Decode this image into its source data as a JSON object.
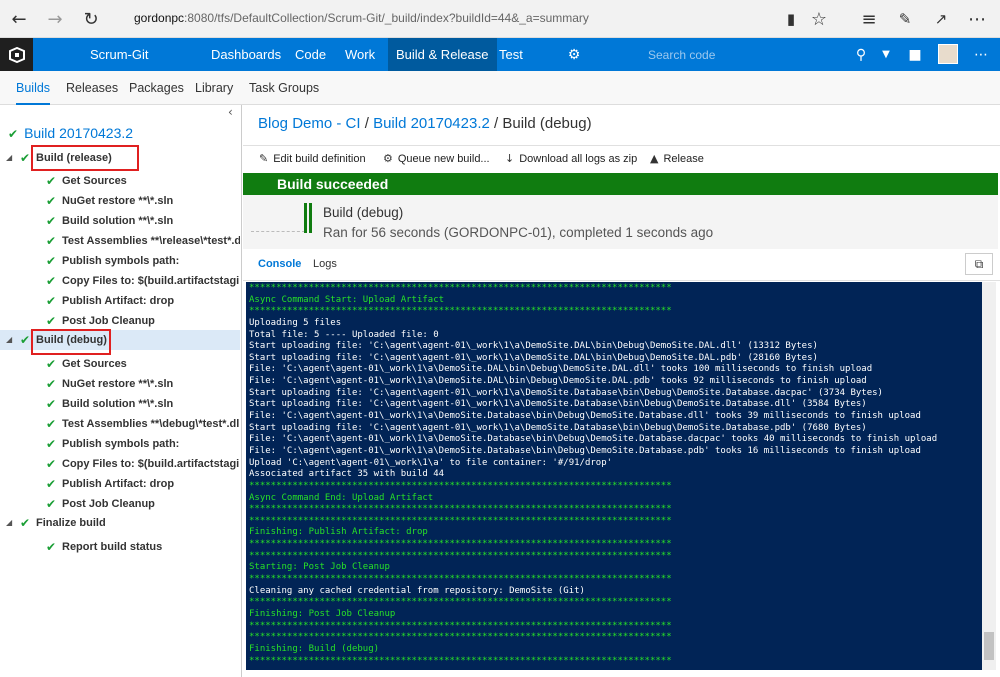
{
  "browser": {
    "url_host": "gordonpc",
    "url_rest": ":8080/tfs/DefaultCollection/Scrum-Git/_build/index?buildId=44&_a=summary",
    "icons": [
      "back-icon",
      "forward-icon",
      "refresh-icon",
      "reading-view-icon",
      "favorite-icon",
      "hub-icon",
      "pen-icon",
      "share-icon",
      "more-icon"
    ]
  },
  "topnav": {
    "project": "Scrum-Git",
    "items": [
      "Dashboards",
      "Code",
      "Work",
      "Build & Release",
      "Test"
    ],
    "active": "Build & Release",
    "search_placeholder": "Search code",
    "accent": "#0078d7"
  },
  "hub": {
    "tabs": [
      "Builds",
      "Releases",
      "Packages",
      "Library",
      "Task Groups"
    ],
    "active": "Builds"
  },
  "tree": {
    "build_name": "Build 20170423.2",
    "nodes": [
      {
        "label": "Build (release)",
        "level": 0
      },
      {
        "label": "Get Sources",
        "level": 1
      },
      {
        "label": "NuGet restore **\\*.sln",
        "level": 1
      },
      {
        "label": "Build solution **\\*.sln",
        "level": 1
      },
      {
        "label": "Test Assemblies **\\release\\*test*.dll;...",
        "level": 1
      },
      {
        "label": "Publish symbols path:",
        "level": 1
      },
      {
        "label": "Copy Files to: $(build.artifactstaging...",
        "level": 1
      },
      {
        "label": "Publish Artifact: drop",
        "level": 1
      },
      {
        "label": "Post Job Cleanup",
        "level": 1
      },
      {
        "label": "Build (debug)",
        "level": 0
      },
      {
        "label": "Get Sources",
        "level": 1
      },
      {
        "label": "NuGet restore **\\*.sln",
        "level": 1
      },
      {
        "label": "Build solution **\\*.sln",
        "level": 1
      },
      {
        "label": "Test Assemblies **\\debug\\*test*.dll;...",
        "level": 1
      },
      {
        "label": "Publish symbols path:",
        "level": 1
      },
      {
        "label": "Copy Files to: $(build.artifactstaging...",
        "level": 1
      },
      {
        "label": "Publish Artifact: drop",
        "level": 1
      },
      {
        "label": "Post Job Cleanup",
        "level": 1
      },
      {
        "label": "Finalize build",
        "level": 0
      },
      {
        "label": "Report build status",
        "level": 1
      }
    ]
  },
  "breadcrumb": {
    "part1": "Blog Demo - CI",
    "sep": " / ",
    "part2": "Build 20170423.2",
    "part3": "Build (debug)"
  },
  "toolbar": {
    "edit": "Edit build definition",
    "queue": "Queue new build...",
    "download": "Download all logs as zip",
    "release": "Release"
  },
  "status": {
    "text": "Build succeeded",
    "color": "#107c10"
  },
  "summary": {
    "title": "Build (debug)",
    "desc": "Ran for 56 seconds (GORDONPC-01), completed 1 seconds ago"
  },
  "log_tabs": [
    "Console",
    "Logs"
  ],
  "console": [
    {
      "t": "******************************************************************************",
      "g": true
    },
    {
      "t": "Async Command Start: Upload Artifact",
      "g": true
    },
    {
      "t": "******************************************************************************",
      "g": true
    },
    {
      "t": "Uploading 5 files",
      "g": false
    },
    {
      "t": "Total file: 5 ---- Uploaded file: 0",
      "g": false
    },
    {
      "t": "Start uploading file: 'C:\\agent\\agent-01\\_work\\1\\a\\DemoSite.DAL\\bin\\Debug\\DemoSite.DAL.dll' (13312 Bytes)",
      "g": false
    },
    {
      "t": "Start uploading file: 'C:\\agent\\agent-01\\_work\\1\\a\\DemoSite.DAL\\bin\\Debug\\DemoSite.DAL.pdb' (28160 Bytes)",
      "g": false
    },
    {
      "t": "File: 'C:\\agent\\agent-01\\_work\\1\\a\\DemoSite.DAL\\bin\\Debug\\DemoSite.DAL.dll' tooks 100 milliseconds to finish upload",
      "g": false
    },
    {
      "t": "File: 'C:\\agent\\agent-01\\_work\\1\\a\\DemoSite.DAL\\bin\\Debug\\DemoSite.DAL.pdb' tooks 92 milliseconds to finish upload",
      "g": false
    },
    {
      "t": "Start uploading file: 'C:\\agent\\agent-01\\_work\\1\\a\\DemoSite.Database\\bin\\Debug\\DemoSite.Database.dacpac' (3734 Bytes)",
      "g": false
    },
    {
      "t": "Start uploading file: 'C:\\agent\\agent-01\\_work\\1\\a\\DemoSite.Database\\bin\\Debug\\DemoSite.Database.dll' (3584 Bytes)",
      "g": false
    },
    {
      "t": "File: 'C:\\agent\\agent-01\\_work\\1\\a\\DemoSite.Database\\bin\\Debug\\DemoSite.Database.dll' tooks 39 milliseconds to finish upload",
      "g": false
    },
    {
      "t": "Start uploading file: 'C:\\agent\\agent-01\\_work\\1\\a\\DemoSite.Database\\bin\\Debug\\DemoSite.Database.pdb' (7680 Bytes)",
      "g": false
    },
    {
      "t": "File: 'C:\\agent\\agent-01\\_work\\1\\a\\DemoSite.Database\\bin\\Debug\\DemoSite.Database.dacpac' tooks 40 milliseconds to finish upload",
      "g": false
    },
    {
      "t": "File: 'C:\\agent\\agent-01\\_work\\1\\a\\DemoSite.Database\\bin\\Debug\\DemoSite.Database.pdb' tooks 16 milliseconds to finish upload",
      "g": false
    },
    {
      "t": "Upload 'C:\\agent\\agent-01\\_work\\1\\a' to file container: '#/91/drop'",
      "g": false
    },
    {
      "t": "Associated artifact 35 with build 44",
      "g": false
    },
    {
      "t": "******************************************************************************",
      "g": true
    },
    {
      "t": "Async Command End: Upload Artifact",
      "g": true
    },
    {
      "t": "******************************************************************************",
      "g": true
    },
    {
      "t": "******************************************************************************",
      "g": true
    },
    {
      "t": "Finishing: Publish Artifact: drop",
      "g": true
    },
    {
      "t": "******************************************************************************",
      "g": true
    },
    {
      "t": "******************************************************************************",
      "g": true
    },
    {
      "t": "Starting: Post Job Cleanup",
      "g": true
    },
    {
      "t": "******************************************************************************",
      "g": true
    },
    {
      "t": "Cleaning any cached credential from repository: DemoSite (Git)",
      "g": false
    },
    {
      "t": "******************************************************************************",
      "g": true
    },
    {
      "t": "Finishing: Post Job Cleanup",
      "g": true
    },
    {
      "t": "******************************************************************************",
      "g": true
    },
    {
      "t": "******************************************************************************",
      "g": true
    },
    {
      "t": "Finishing: Build (debug)",
      "g": true
    },
    {
      "t": "******************************************************************************",
      "g": true
    }
  ]
}
